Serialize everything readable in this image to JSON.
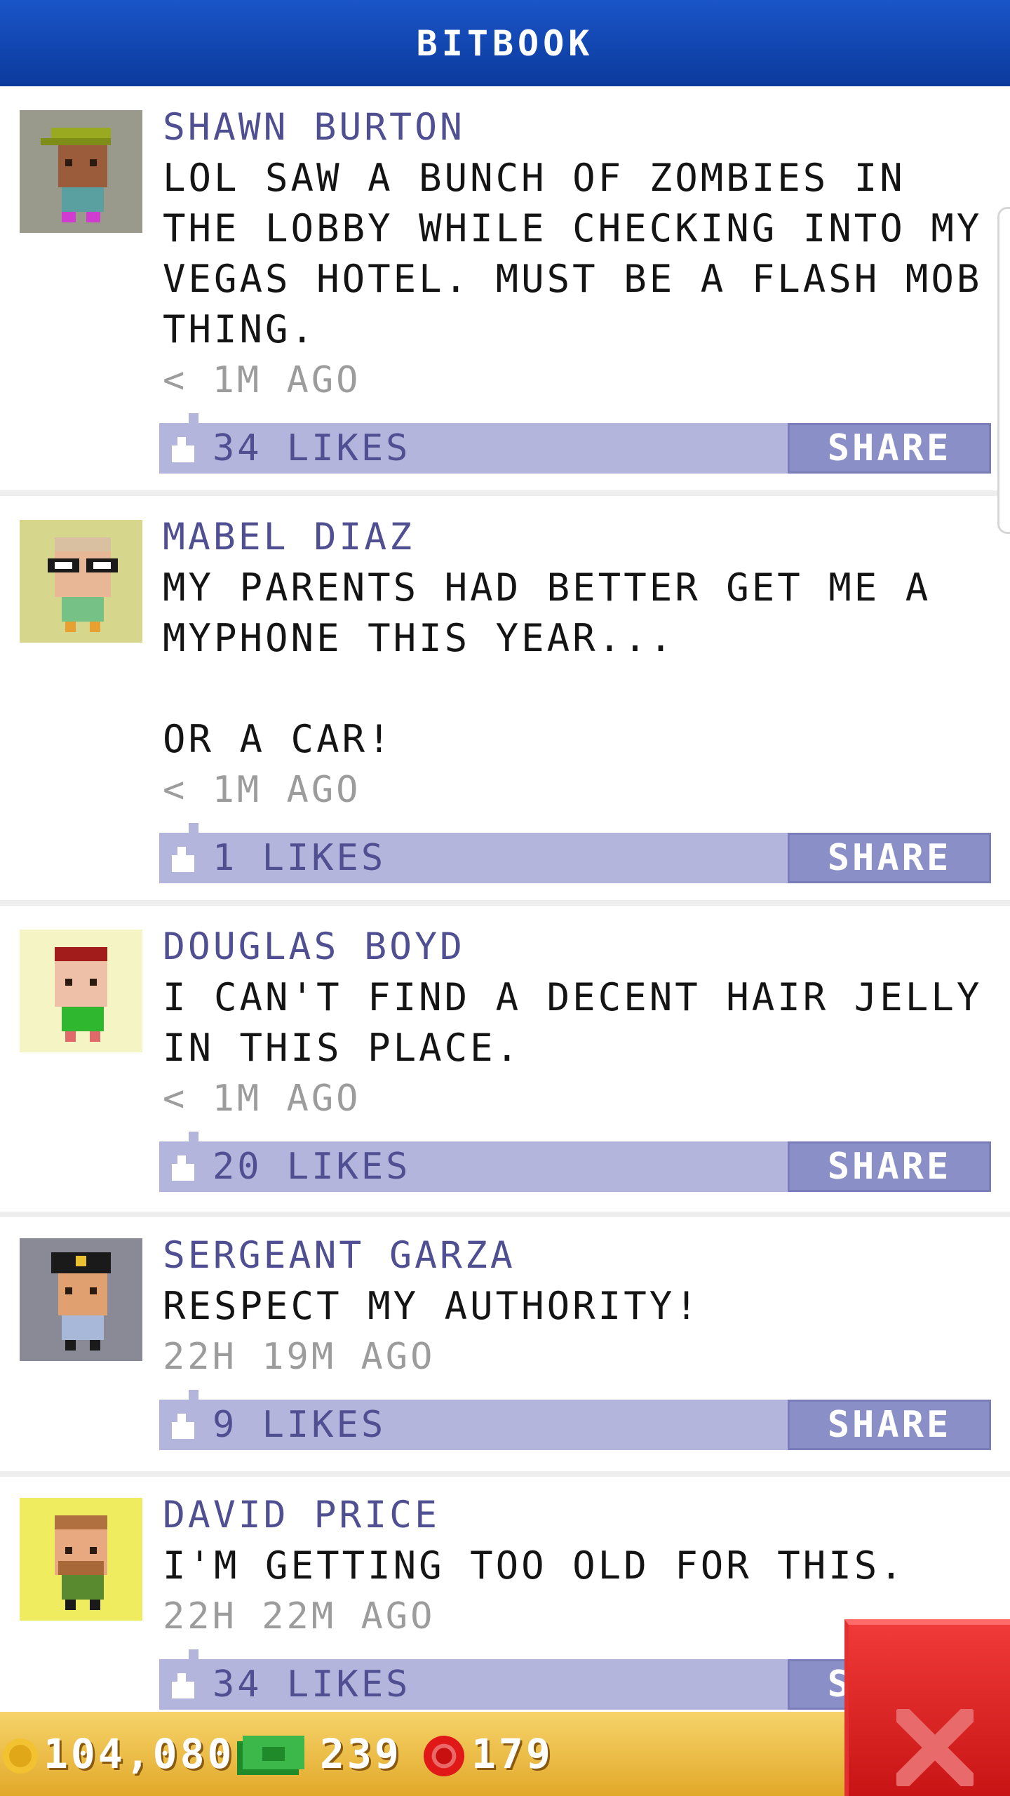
{
  "header": {
    "title": "BITBOOK"
  },
  "posts": [
    {
      "name": "SHAWN BURTON",
      "text": "LOL SAW A BUNCH OF ZOMBIES IN THE LOBBY WHILE CHECKING INTO MY VEGAS HOTEL. MUST BE A FLASH MOB THING.",
      "time": "< 1M AGO",
      "likes": "34 LIKES",
      "share": "SHARE"
    },
    {
      "name": "MABEL DIAZ",
      "text": "MY PARENTS HAD BETTER GET ME A MYPHONE THIS YEAR...\n\nOR A CAR!",
      "time": "< 1M AGO",
      "likes": "1 LIKES",
      "share": "SHARE"
    },
    {
      "name": "DOUGLAS BOYD",
      "text": "I CAN'T FIND A DECENT HAIR JELLY IN THIS PLACE.",
      "time": "< 1M AGO",
      "likes": "20 LIKES",
      "share": "SHARE"
    },
    {
      "name": "SERGEANT GARZA",
      "text": "RESPECT MY AUTHORITY!",
      "time": "22H 19M AGO",
      "likes": "9 LIKES",
      "share": "SHARE"
    },
    {
      "name": "DAVID PRICE",
      "text": "I'M GETTING TOO OLD FOR THIS.",
      "time": "22H 22M AGO",
      "likes": "34 LIKES",
      "share": "SHARE"
    }
  ],
  "footer": {
    "coins": "104,080",
    "bux": "239",
    "chips": "179"
  },
  "colors": {
    "header": "#0b3a9c",
    "name": "#4f4f92",
    "likebar": "#b3b5dd",
    "share": "#8b8fc7",
    "footer": "#e2a92a",
    "close": "#d81e1e"
  },
  "icons": {
    "like": "thumbs-up-icon",
    "coin": "coin-icon",
    "bux": "bux-bill-icon",
    "chip": "poker-chip-icon",
    "close": "close-icon"
  }
}
